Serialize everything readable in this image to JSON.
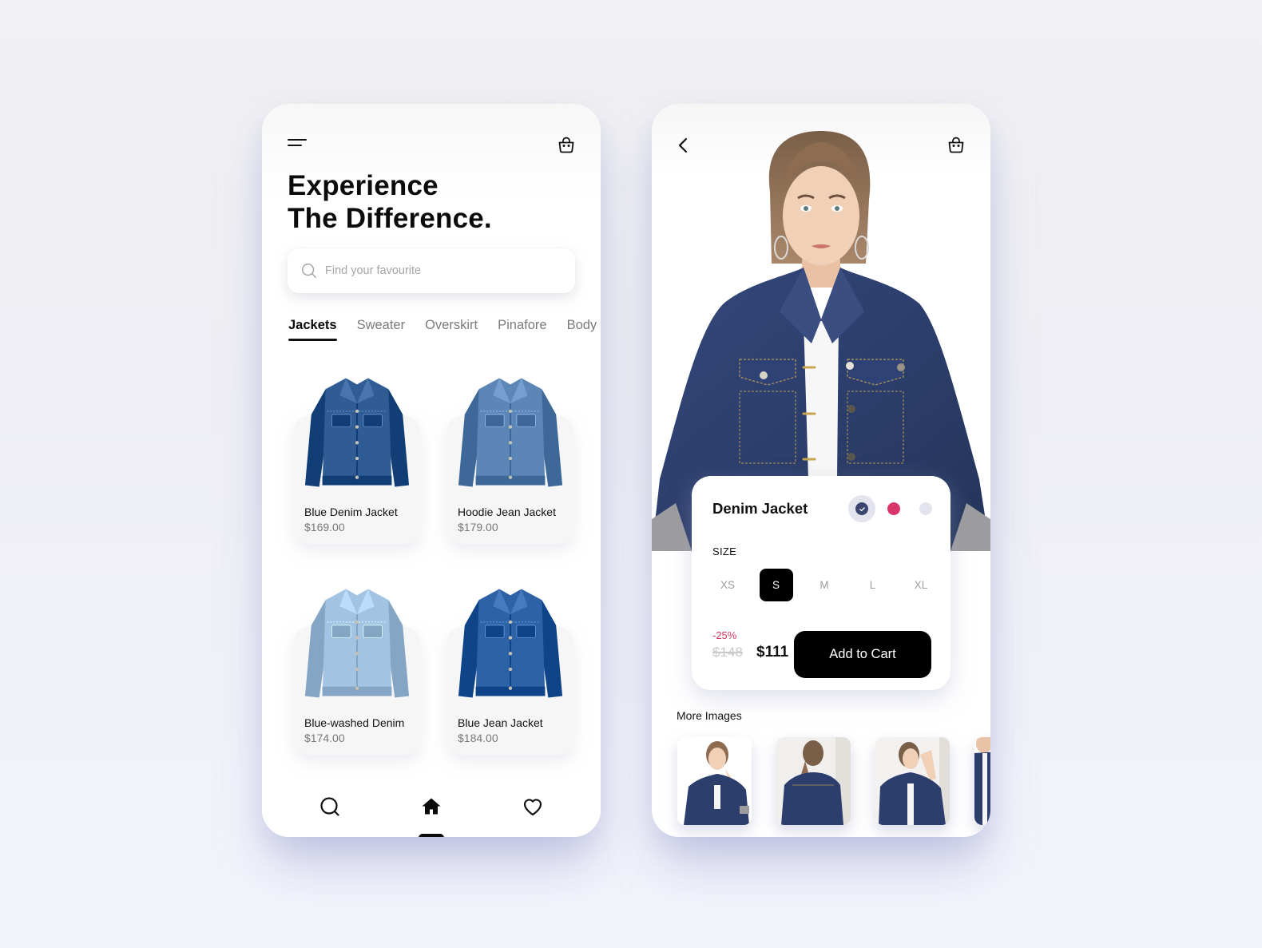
{
  "home_screen": {
    "menu_icon": "hamburger-menu-icon",
    "cart_icon": "shopping-bag-icon",
    "headline_line1": "Experience",
    "headline_line2": "The Difference.",
    "search": {
      "placeholder": "Find your favourite",
      "value": "",
      "icon": "search-icon"
    },
    "categories": [
      {
        "label": "Jackets",
        "active": true
      },
      {
        "label": "Sweater",
        "active": false
      },
      {
        "label": "Overskirt",
        "active": false
      },
      {
        "label": "Pinafore",
        "active": false
      },
      {
        "label": "Body",
        "active": false
      }
    ],
    "products": [
      {
        "name": "Blue Denim Jacket",
        "price": "$169.00",
        "denim_color": "#2f5c93"
      },
      {
        "name": "Hoodie Jean Jacket",
        "price": "$179.00",
        "denim_color": "#5b86b6"
      },
      {
        "name": "Blue-washed Denim",
        "price": "$174.00",
        "denim_color": "#a3c3e2"
      },
      {
        "name": "Blue Jean Jacket",
        "price": "$184.00",
        "denim_color": "#2e62a6"
      }
    ],
    "bottom_nav": [
      {
        "icon": "search-icon",
        "active": false
      },
      {
        "icon": "home-icon",
        "active": true
      },
      {
        "icon": "heart-icon",
        "active": false
      }
    ]
  },
  "detail_screen": {
    "back_icon": "chevron-left-icon",
    "cart_icon": "shopping-bag-icon",
    "product_name": "Denim Jacket",
    "colors": [
      {
        "hex": "#3a4670",
        "selected": true
      },
      {
        "hex": "#d8366a",
        "selected": false
      },
      {
        "hex": "#e4e4ef",
        "selected": false
      }
    ],
    "size_label": "SIZE",
    "sizes": [
      {
        "label": "XS",
        "selected": false
      },
      {
        "label": "S",
        "selected": true
      },
      {
        "label": "M",
        "selected": false
      },
      {
        "label": "L",
        "selected": false
      },
      {
        "label": "XL",
        "selected": false
      }
    ],
    "discount": "-25%",
    "original_price": "$148",
    "sale_price": "$111",
    "add_to_cart_label": "Add to Cart",
    "more_images_title": "More Images",
    "more_images_count_visible": 4
  }
}
